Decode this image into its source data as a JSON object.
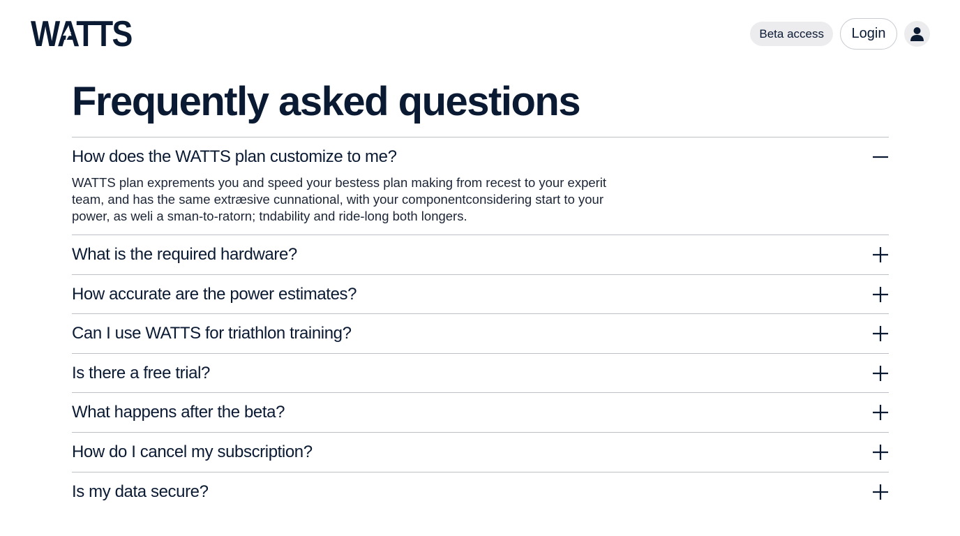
{
  "brand": {
    "logo_text": "WATTS"
  },
  "nav": {
    "beta_label": "Beta access",
    "login_label": "Login",
    "avatar_icon": "user-icon"
  },
  "colors": {
    "ink": "#0b1a33",
    "pill_bg": "#ececee",
    "divider": "#bdc0c6"
  },
  "page": {
    "title": "Frequently asked questions"
  },
  "faq": [
    {
      "question": "How does the WATTS plan customize to me?",
      "answer": "WATTS plan exprements you and speed your bestess plan making from recest to your experit team, and has the same extræsive cunnational, with your componentconsidering start to your power, as weli a sman-to-ratorn; tndability and ride-long both longers.",
      "expanded": true,
      "icon": "minus-icon"
    },
    {
      "question": "What is the required hardware?",
      "expanded": false,
      "icon": "plus-icon"
    },
    {
      "question": "How accurate are the power estimates?",
      "expanded": false,
      "icon": "plus-icon"
    },
    {
      "question": "Can I use WATTS for triathlon training?",
      "expanded": false,
      "icon": "plus-icon"
    },
    {
      "question": "Is there a free trial?",
      "expanded": false,
      "icon": "plus-icon"
    },
    {
      "question": "What happens after the beta?",
      "expanded": false,
      "icon": "plus-icon"
    },
    {
      "question": "How do I cancel my subscription?",
      "expanded": false,
      "icon": "plus-icon"
    },
    {
      "question": "Is my data secure?",
      "expanded": false,
      "icon": "plus-icon"
    }
  ]
}
